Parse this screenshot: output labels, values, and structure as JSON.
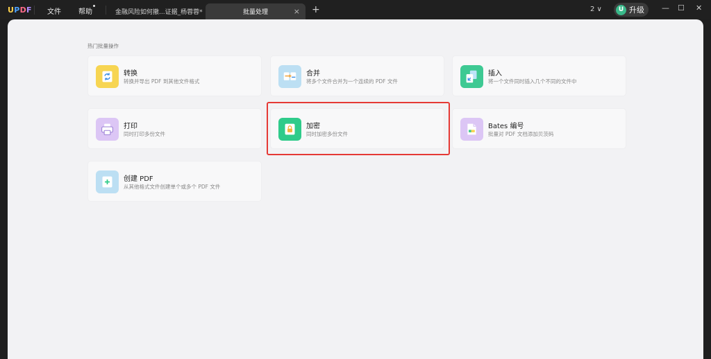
{
  "titlebar": {
    "logo": {
      "u": "U",
      "p": "P",
      "d": "D",
      "f": "F"
    },
    "menu": {
      "file": "文件",
      "help": "帮助"
    },
    "tabs": [
      {
        "label": "金融风险如何撤...证据_杨蓉蓉*"
      },
      {
        "label": "批量处理",
        "close": "×"
      }
    ],
    "new_tab": "+",
    "page_select": "2 ∨",
    "upgrade": {
      "avatar_letter": "U",
      "label": "升级"
    },
    "window": {
      "minimize": "—",
      "maximize": "☐",
      "close": "✕"
    }
  },
  "main": {
    "section_title": "热门批量操作",
    "cards": [
      {
        "title": "转换",
        "desc": "转换并导出 PDF 到其他文件格式",
        "icon": "convert-icon",
        "color": "#f7d552"
      },
      {
        "title": "合并",
        "desc": "将多个文件合并为一个连续的 PDF 文件",
        "icon": "merge-icon",
        "color": "#bcdff3"
      },
      {
        "title": "插入",
        "desc": "将一个文件同时插入几个不同的文件中",
        "icon": "insert-icon",
        "color": "#3ec993"
      },
      {
        "title": "打印",
        "desc": "同时打印多份文件",
        "icon": "print-icon",
        "color": "#dcc6f5"
      },
      {
        "title": "加密",
        "desc": "同时加密多份文件",
        "icon": "lock-icon",
        "color": "#2fcb8a"
      },
      {
        "title": "Bates 编号",
        "desc": "批量对 PDF 文档添加贝茨码",
        "icon": "bates-icon",
        "color": "#dcc6f5"
      },
      {
        "title": "创建 PDF",
        "desc": "从其他格式文件创建单个或多个 PDF 文件",
        "icon": "create-pdf-icon",
        "color": "#bcdff3"
      }
    ]
  }
}
